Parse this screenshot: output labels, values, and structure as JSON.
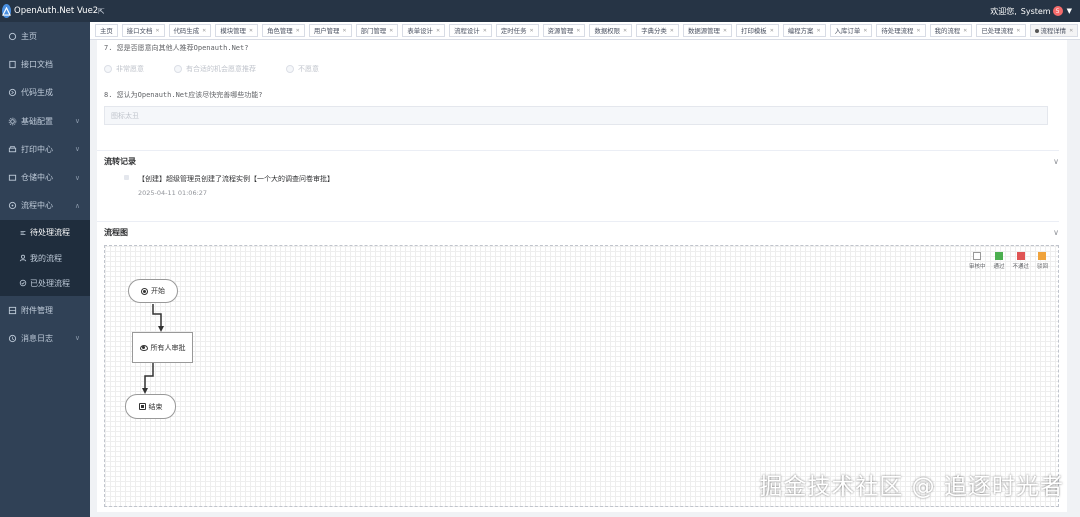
{
  "app": {
    "title": "OpenAuth.Net Vue2",
    "welcome": "欢迎您,",
    "user": "System",
    "badge": "5"
  },
  "sidebar": {
    "items": [
      {
        "label": "主页"
      },
      {
        "label": "接口文档"
      },
      {
        "label": "代码生成"
      },
      {
        "label": "基础配置"
      },
      {
        "label": "打印中心"
      },
      {
        "label": "仓储中心"
      },
      {
        "label": "流程中心"
      }
    ],
    "sub_items": [
      {
        "label": "待处理流程"
      },
      {
        "label": "我的流程"
      },
      {
        "label": "已处理流程"
      }
    ],
    "bottom_items": [
      {
        "label": "附件管理"
      },
      {
        "label": "消息日志"
      }
    ]
  },
  "tabs": [
    "主页",
    "接口文档",
    "代码生成",
    "模块管理",
    "角色管理",
    "用户管理",
    "部门管理",
    "表单设计",
    "流程设计",
    "定时任务",
    "资源管理",
    "数据权限",
    "字典分类",
    "数据源管理",
    "打印模板",
    "编程方案",
    "入库订单",
    "待处理流程",
    "我的流程",
    "已处理流程",
    "流程详情"
  ],
  "form": {
    "q7": "7. 您是否愿意向其他人推荐Openauth.Net?",
    "q7_options": [
      "非常愿意",
      "有合适的机会愿意推荐",
      "不愿意"
    ],
    "q8": "8. 您认为Openauth.Net应该尽快完善哪些功能?",
    "q8_placeholder": "图标太丑"
  },
  "history": {
    "title": "流转记录",
    "entry_text": "【创建】超级管理员创建了流程实例【一个大的调查问卷审批】",
    "entry_time": "2025-04-11 01:06:27"
  },
  "flow": {
    "title": "流程图",
    "legend": [
      {
        "label": "审核中",
        "color": "#ffffff"
      },
      {
        "label": "通过",
        "color": "#4caf50"
      },
      {
        "label": "不通过",
        "color": "#e05555"
      },
      {
        "label": "驳回",
        "color": "#f0a33c"
      }
    ],
    "nodes": {
      "start": "开始",
      "approve": "所有人审批",
      "end": "结束"
    }
  },
  "watermark": "掘金技术社区 @ 追逐时光者"
}
